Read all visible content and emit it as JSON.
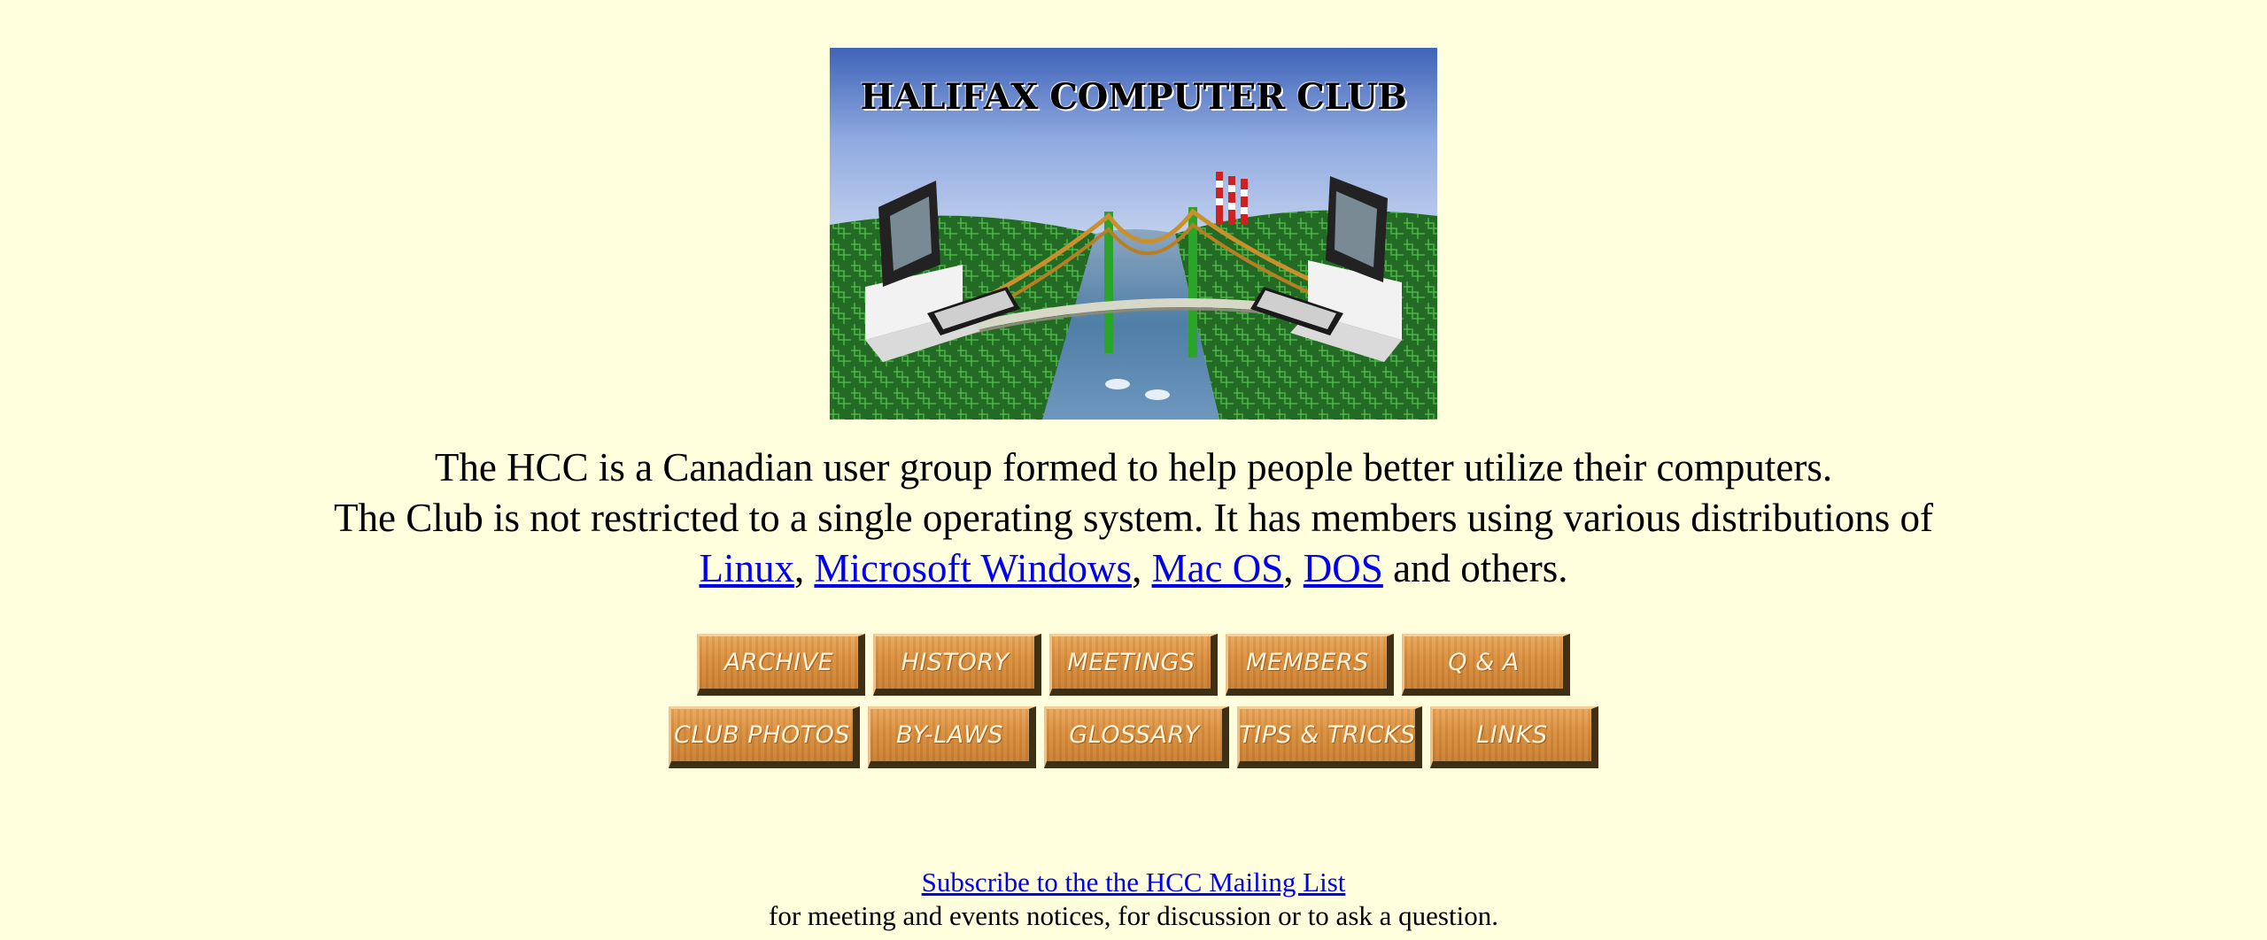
{
  "banner": {
    "title": "HALIFAX COMPUTER CLUB"
  },
  "intro": {
    "line1": "The HCC is a Canadian user group formed to help people better utilize their computers.",
    "line2": "The Club is not restricted to a single operating system. It has members using various distributions of",
    "links": {
      "linux": "Linux",
      "windows": "Microsoft Windows",
      "macos": "Mac OS",
      "dos": "DOS"
    },
    "separator": ",",
    "tail": "and others."
  },
  "nav": {
    "row1": [
      {
        "label": "ARCHIVE"
      },
      {
        "label": "HISTORY"
      },
      {
        "label": "MEETINGS"
      },
      {
        "label": "MEMBERS"
      },
      {
        "label": "Q & A"
      }
    ],
    "row2": [
      {
        "label": "CLUB PHOTOS"
      },
      {
        "label": "BY-LAWS"
      },
      {
        "label": "GLOSSARY"
      },
      {
        "label": "TIPS & TRICKS"
      },
      {
        "label": "LINKS"
      }
    ]
  },
  "footer": {
    "subscribe_link": "Subscribe to the the HCC Mailing List",
    "note": "for meeting and events notices, for discussion or to ask a question."
  },
  "colors": {
    "background": "#FFFFDD",
    "link": "#0000EE",
    "button_wood": "#D98E3E",
    "button_shadow": "#3E3014"
  }
}
